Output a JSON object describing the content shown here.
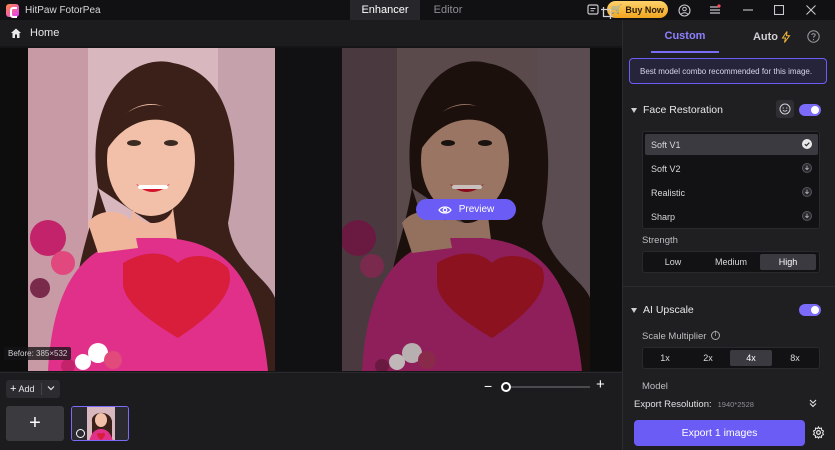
{
  "app": {
    "title": "HitPaw FotorPea"
  },
  "top_tabs": [
    {
      "label": "Enhancer",
      "active": true
    },
    {
      "label": "Editor",
      "active": false
    }
  ],
  "buy_button": {
    "label": "Buy Now"
  },
  "breadcrumb": {
    "home": "Home"
  },
  "canvas": {
    "before_label": "Before: 385×532",
    "preview_label": "Preview"
  },
  "bottom": {
    "add_label": "Add",
    "zoom_level": 0
  },
  "panel": {
    "tabs": [
      {
        "label": "Custom",
        "active": true
      },
      {
        "label": "Auto",
        "active": false
      }
    ],
    "note": "Best model combo recommended for this image.",
    "face_restoration": {
      "title": "Face Restoration",
      "enabled": true,
      "models": [
        {
          "label": "Soft V1",
          "selected": true,
          "icon": "check-icon"
        },
        {
          "label": "Soft V2",
          "selected": false,
          "icon": "download-icon"
        },
        {
          "label": "Realistic",
          "selected": false,
          "icon": "download-icon"
        },
        {
          "label": "Sharp",
          "selected": false,
          "icon": "download-icon"
        }
      ],
      "strength_label": "Strength",
      "strength_options": [
        "Low",
        "Medium",
        "High"
      ],
      "strength_selected": "High"
    },
    "ai_upscale": {
      "title": "AI Upscale",
      "enabled": true,
      "scale_label": "Scale Multiplier",
      "scale_options": [
        "1x",
        "2x",
        "4x",
        "8x"
      ],
      "scale_selected": "4x",
      "model_label": "Model"
    },
    "export_resolution_label": "Export Resolution:",
    "export_resolution_value": "1940*2528",
    "export_button": "Export 1 images"
  },
  "colors": {
    "accent": "#6b5cf6",
    "accent_light": "#8d80ff",
    "buy_gold": "#f0a520",
    "sweater_pink": "#e0308a",
    "heart_red": "#d81e3a"
  }
}
